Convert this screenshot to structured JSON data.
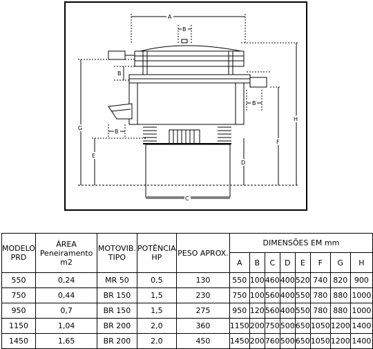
{
  "drawing": {
    "dim_labels": {
      "a": "A",
      "b": "B",
      "c": "C",
      "d": "D",
      "e": "E",
      "f": "F",
      "g": "G",
      "h": "H"
    }
  },
  "table": {
    "headers": {
      "modelo": "MODELO PRD",
      "area": "ÁREA Peneiramento m2",
      "motovib": "MOTOVIB. TIPO",
      "potencia": "POTÊNCIA HP",
      "peso": "PESO APROX.",
      "dimensoes": "DIMENSÕES EM mm",
      "dims": [
        "A",
        "B",
        "C",
        "D",
        "E",
        "F",
        "G",
        "H"
      ]
    },
    "rows": [
      {
        "modelo": "550",
        "area": "0,24",
        "motovib": "MR 50",
        "potencia": "0,5",
        "peso": "130",
        "dims": [
          "550",
          "100",
          "460",
          "400",
          "520",
          "740",
          "820",
          "900"
        ]
      },
      {
        "modelo": "750",
        "area": "0,44",
        "motovib": "BR 150",
        "potencia": "1,5",
        "peso": "230",
        "dims": [
          "750",
          "100",
          "560",
          "400",
          "550",
          "780",
          "880",
          "1000"
        ]
      },
      {
        "modelo": "950",
        "area": "0,7",
        "motovib": "BR 150",
        "potencia": "1,5",
        "peso": "275",
        "dims": [
          "950",
          "120",
          "560",
          "400",
          "550",
          "780",
          "880",
          "1000"
        ]
      },
      {
        "modelo": "1150",
        "area": "1,04",
        "motovib": "BR 200",
        "potencia": "2,0",
        "peso": "360",
        "dims": [
          "1150",
          "200",
          "750",
          "500",
          "650",
          "1050",
          "1200",
          "1400"
        ]
      },
      {
        "modelo": "1450",
        "area": "1,65",
        "motovib": "BR 200",
        "potencia": "2,0",
        "peso": "450",
        "dims": [
          "1450",
          "200",
          "760",
          "500",
          "650",
          "1050",
          "1200",
          "1400"
        ]
      }
    ]
  }
}
